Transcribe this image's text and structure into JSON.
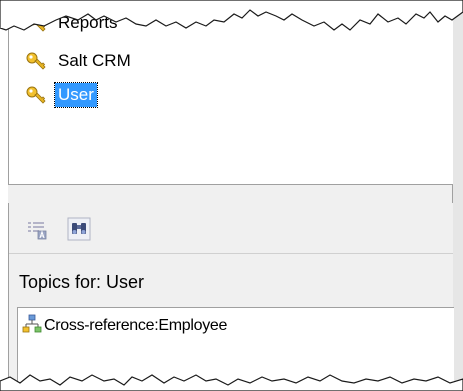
{
  "tree": {
    "items": [
      {
        "label": "Reports",
        "icon": "key-icon",
        "selected": false
      },
      {
        "label": "Salt CRM",
        "icon": "key-icon",
        "selected": false
      },
      {
        "label": "User",
        "icon": "key-icon",
        "selected": true
      }
    ]
  },
  "toolbar": {
    "buttons": [
      {
        "icon": "sort-list-icon",
        "enabled": false
      },
      {
        "icon": "find-binoculars-icon",
        "enabled": true
      }
    ]
  },
  "topics": {
    "header": "Topics for: User",
    "items": [
      {
        "label": "Cross-reference:Employee",
        "icon": "cross-reference-icon"
      }
    ]
  },
  "colors": {
    "selection": "#3399ff",
    "panel_bg": "#f0f0f0",
    "border": "#a0a0a0"
  }
}
